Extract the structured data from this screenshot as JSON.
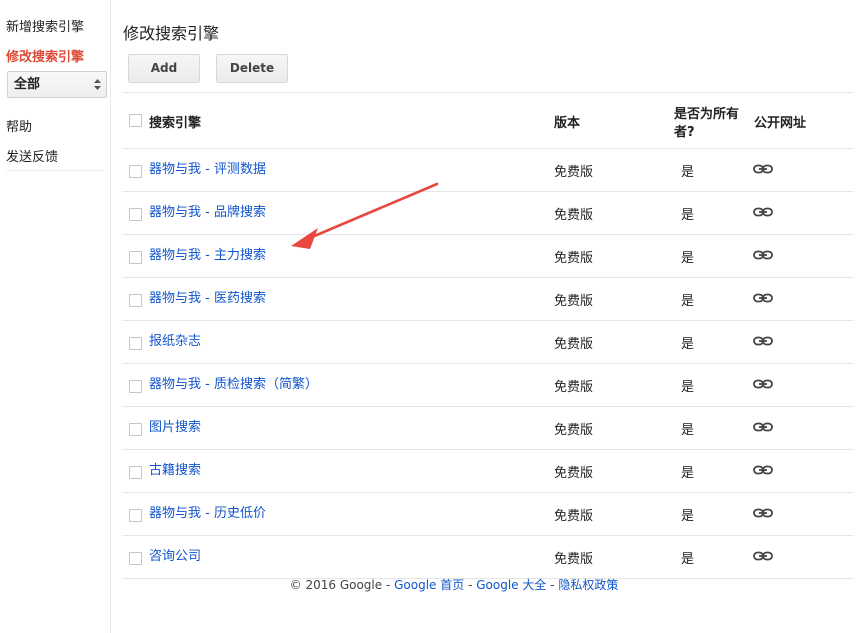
{
  "sidebar": {
    "new_engine": "新增搜索引擎",
    "edit_engine": "修改搜索引擎",
    "select_value": "全部",
    "help": "帮助",
    "feedback": "发送反馈"
  },
  "main": {
    "title": "修改搜索引擎",
    "add_label": "Add",
    "delete_label": "Delete"
  },
  "table": {
    "headers": {
      "name": "搜索引擎",
      "edition": "版本",
      "owner_line1": "是否为所有",
      "owner_line2": "者?",
      "public_url": "公开网址"
    },
    "rows": [
      {
        "name": "器物与我 - 评测数据",
        "edition": "免费版",
        "owner": "是",
        "link_icon": "link-icon"
      },
      {
        "name": "器物与我 - 品牌搜索",
        "edition": "免费版",
        "owner": "是",
        "link_icon": "link-icon"
      },
      {
        "name": "器物与我 - 主力搜索",
        "edition": "免费版",
        "owner": "是",
        "link_icon": "link-icon"
      },
      {
        "name": "器物与我 - 医药搜索",
        "edition": "免费版",
        "owner": "是",
        "link_icon": "link-icon"
      },
      {
        "name": "报纸杂志",
        "edition": "免费版",
        "owner": "是",
        "link_icon": "link-icon"
      },
      {
        "name": "器物与我 - 质检搜索（简繁）",
        "edition": "免费版",
        "owner": "是",
        "link_icon": "link-icon"
      },
      {
        "name": "图片搜索",
        "edition": "免费版",
        "owner": "是",
        "link_icon": "link-icon"
      },
      {
        "name": "古籍搜索",
        "edition": "免费版",
        "owner": "是",
        "link_icon": "link-icon"
      },
      {
        "name": "器物与我 - 历史低价",
        "edition": "免费版",
        "owner": "是",
        "link_icon": "link-icon"
      },
      {
        "name": "咨询公司",
        "edition": "免费版",
        "owner": "是",
        "link_icon": "link-icon"
      }
    ]
  },
  "footer": {
    "copyright": "© 2016 Google",
    "sep1": " - ",
    "home": "Google 首页",
    "sep2": " - ",
    "about": "Google 大全",
    "sep3": " - ",
    "privacy": "隐私权政策"
  },
  "colors": {
    "accent_red": "#dd4b39",
    "link_blue": "#1155cc",
    "annotation_arrow": "#e8473f"
  }
}
